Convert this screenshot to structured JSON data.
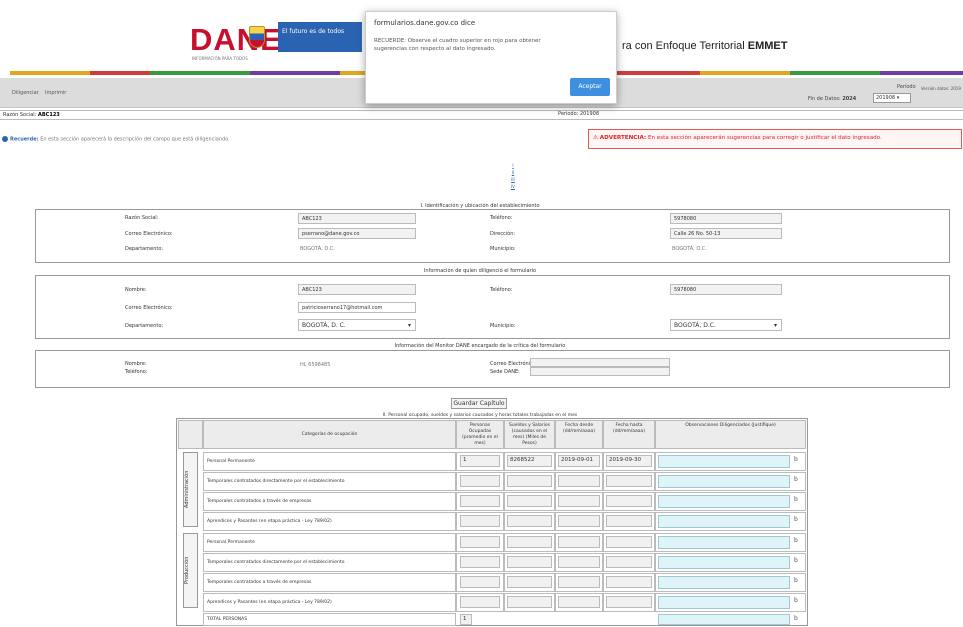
{
  "header": {
    "logo_text": "DANE",
    "logo_subtext": "INFORMACIÓN PARA TODOS",
    "gov_box_text": "El futuro es de todos",
    "title_prefix": "ra con Enfoque Territorial",
    "title_bold": "EMMET"
  },
  "toolbar": {
    "link_1": "Diligenciar",
    "link_2": "Imprimir",
    "periodo_label": "Período",
    "fecha_label_prefix": "Fin de Datos:",
    "fecha_year": "2024",
    "periodo_value": "201908",
    "ajuste_label": "Versión datos: 2019"
  },
  "info": {
    "razon_label": "Razón Social:",
    "razon_value": "ABC123",
    "periodo_label": "Periodo:",
    "periodo_value": "201908",
    "recuerde_bold": "Recuerde:",
    "recuerde_text": "En esta sección aparecerá la descripción del campo que está diligenciando.",
    "advertencia_bold": "ADVERTENCIA:",
    "advertencia_text": "En esta sección aparecerán sugerencias para corregir o justificar el dato ingresado."
  },
  "index_links": [
    "I",
    "II",
    "III",
    "IV"
  ],
  "section1": {
    "title": "I. Identificación y ubicación del establecimiento",
    "razon_label": "Razón Social:",
    "razon_value": "ABC123",
    "correo_label": "Correo Electrónico:",
    "correo_value": "pserrano@dane.gov.co",
    "depto_label": "Departamento:",
    "depto_value": "BOGOTÁ, D.C.",
    "tel_label": "Teléfono:",
    "tel_value": "5978080",
    "dir_label": "Dirección:",
    "dir_value": "Calle 26 No. 50-13",
    "mun_label": "Municipio:",
    "mun_value": "BOGOTÁ, D.C."
  },
  "section2": {
    "title": "Información de quien diligenció el formulario",
    "nombre_label": "Nombre:",
    "nombre_value": "ABC123",
    "correo_label": "Correo Electrónico:",
    "correo_value": "patricioserrano17@hotmail.com",
    "depto_label": "Departamento:",
    "depto_value": "BOGOTÁ, D. C.",
    "tel_label": "Teléfono:",
    "tel_value": "5978080",
    "mun_label": "Municipio:",
    "mun_value": "BOGOTÁ, D.C."
  },
  "section3": {
    "title": "Información del Monitor DANE encargado de la crítica del formulario",
    "nombre_label": "Nombre:",
    "nombre_value": "HL 6598485",
    "tel_label": "Teléfono:",
    "correo_label": "Correo Electrónico:",
    "sede_label": "Sede DANE:"
  },
  "save_button": "Guardar Capítulo",
  "table": {
    "title": "II. Personal ocupado, sueldos y salarios causados y horas totales trabajadas en el mes",
    "headers": {
      "categoria": "Categorías de ocupación",
      "personas": "Personas Ocupadas (promedio en el mes)",
      "sueldos": "Sueldos y Salarios (causados en el mes) (Miles de Pesos)",
      "fecha_desde": "Fecha desde (dd/mm/aaaa)",
      "fecha_hasta": "Fecha hasta (dd/mm/aaaa)",
      "observaciones": "Observaciones Diligenciados (Justifique)"
    },
    "group_admin": "Administración",
    "group_prod": "Producción",
    "rows_admin": [
      {
        "categoria": "Personal Permanente",
        "personas": "1",
        "sueldos": "8268522",
        "desde": "2019-09-01",
        "hasta": "2019-09-30"
      },
      {
        "categoria": "Temporales contratados directamente por el establecimiento",
        "personas": "",
        "sueldos": "",
        "desde": "",
        "hasta": ""
      },
      {
        "categoria": "Temporales contratados a través de empresas",
        "personas": "",
        "sueldos": "",
        "desde": "",
        "hasta": ""
      },
      {
        "categoria": "Aprendices y Pasantes (en etapa práctica - Ley 789/02)",
        "personas": "",
        "sueldos": "",
        "desde": "",
        "hasta": ""
      }
    ],
    "rows_prod": [
      {
        "categoria": "Personal Permanente",
        "personas": "",
        "sueldos": "",
        "desde": "",
        "hasta": ""
      },
      {
        "categoria": "Temporales contratados directamente por el establecimiento",
        "personas": "",
        "sueldos": "",
        "desde": "",
        "hasta": ""
      },
      {
        "categoria": "Temporales contratados a través de empresas",
        "personas": "",
        "sueldos": "",
        "desde": "",
        "hasta": ""
      },
      {
        "categoria": "Aprendices y Pasantes (en etapa práctica - Ley 789/02)",
        "personas": "",
        "sueldos": "",
        "desde": "",
        "hasta": ""
      }
    ],
    "total_label": "TOTAL PERSONAS",
    "total_value": "1"
  },
  "popup": {
    "title": "formularios.dane.gov.co dice",
    "message": "RECUERDE: Observe el cuadro superior en rojo para obtener sugerencias con respecto al dato ingresado.",
    "button": "Aceptar"
  },
  "colors": {
    "dane_red": "#c8102e",
    "gov_blue": "#2b63b3",
    "warning_red": "#dd2222",
    "popup_button": "#3f8fe0",
    "observ_cyan": "#dff4f8"
  }
}
